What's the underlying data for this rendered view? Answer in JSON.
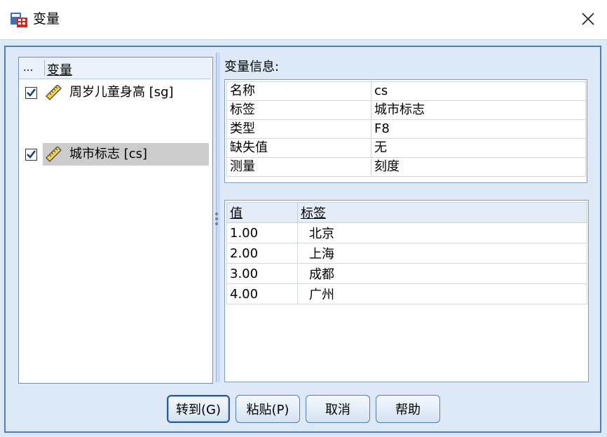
{
  "window": {
    "title": "变量",
    "icon": "spss-variables-icon",
    "close_icon": "close-icon"
  },
  "variable_list": {
    "header_dots": "...",
    "header_label": "变量",
    "items": [
      {
        "label": "周岁儿童身高 [sg]",
        "checked": true,
        "icon": "scale-ruler-icon",
        "selected": false
      },
      {
        "label": "城市标志 [cs]",
        "checked": true,
        "icon": "scale-ruler-icon",
        "selected": true
      }
    ]
  },
  "info": {
    "title": "变量信息:",
    "rows": [
      {
        "key": "名称",
        "value": "cs"
      },
      {
        "key": "标签",
        "value": "城市标志"
      },
      {
        "key": "类型",
        "value": "F8"
      },
      {
        "key": "缺失值",
        "value": "无"
      },
      {
        "key": "测量",
        "value": "刻度"
      }
    ]
  },
  "value_labels": {
    "col_value": "值",
    "col_label": "标签",
    "rows": [
      {
        "value": "1.00",
        "label": "北京"
      },
      {
        "value": "2.00",
        "label": "上海"
      },
      {
        "value": "3.00",
        "label": "成都"
      },
      {
        "value": "4.00",
        "label": "广州"
      }
    ]
  },
  "buttons": {
    "goto": "转到(G)",
    "paste": "粘贴(P)",
    "cancel": "取消",
    "help": "帮助"
  },
  "colors": {
    "accent": "#4a7fc0",
    "panel": "#dde9f7",
    "check": "#1a3f7a"
  }
}
